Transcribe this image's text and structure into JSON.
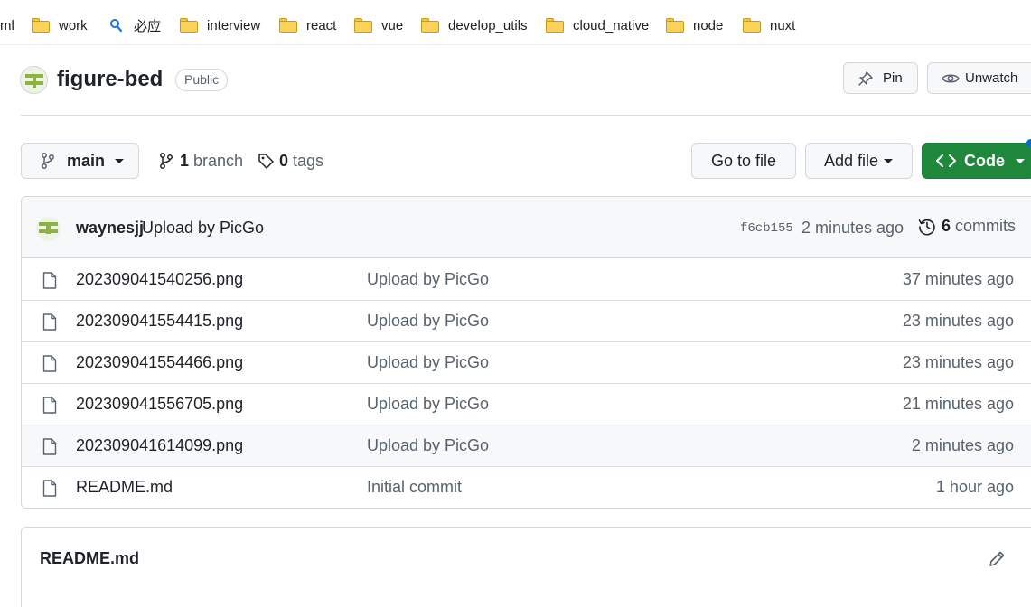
{
  "bookmarks": [
    {
      "label": "ml",
      "icon": "none"
    },
    {
      "label": "work",
      "icon": "folder-icon"
    },
    {
      "label": "必应",
      "icon": "search-icon"
    },
    {
      "label": "interview",
      "icon": "folder-icon"
    },
    {
      "label": "react",
      "icon": "folder-icon"
    },
    {
      "label": "vue",
      "icon": "folder-icon"
    },
    {
      "label": "develop_utils",
      "icon": "folder-icon"
    },
    {
      "label": "cloud_native",
      "icon": "folder-icon"
    },
    {
      "label": "node",
      "icon": "folder-icon"
    },
    {
      "label": "nuxt",
      "icon": "folder-icon"
    }
  ],
  "repo": {
    "name": "figure-bed",
    "visibility": "Public",
    "pin_label": "Pin",
    "unwatch_label": "Unwatch"
  },
  "toolbar": {
    "branch": "main",
    "branch_count": "1",
    "branch_label": "branch",
    "tag_count": "0",
    "tag_label": "tags",
    "go_to_file": "Go to file",
    "add_file": "Add file",
    "code": "Code"
  },
  "latest_commit": {
    "author": "waynesjj",
    "message": "Upload by PicGo",
    "sha": "f6cb155",
    "time": "2 minutes ago",
    "commit_count": "6",
    "commit_label": "commits"
  },
  "files": [
    {
      "name": "202309041540256.png",
      "message": "Upload by PicGo",
      "time": "37 minutes ago"
    },
    {
      "name": "202309041554415.png",
      "message": "Upload by PicGo",
      "time": "23 minutes ago"
    },
    {
      "name": "202309041554466.png",
      "message": "Upload by PicGo",
      "time": "23 minutes ago"
    },
    {
      "name": "202309041556705.png",
      "message": "Upload by PicGo",
      "time": "21 minutes ago"
    },
    {
      "name": "202309041614099.png",
      "message": "Upload by PicGo",
      "time": "2 minutes ago"
    },
    {
      "name": "README.md",
      "message": "Initial commit",
      "time": "1 hour ago"
    }
  ],
  "readme": {
    "title": "README.md"
  },
  "colors": {
    "accent_green": "#1f883d",
    "link_blue": "#0969da",
    "muted_text": "#59636e",
    "folder_yellow": "#fbd35a"
  }
}
